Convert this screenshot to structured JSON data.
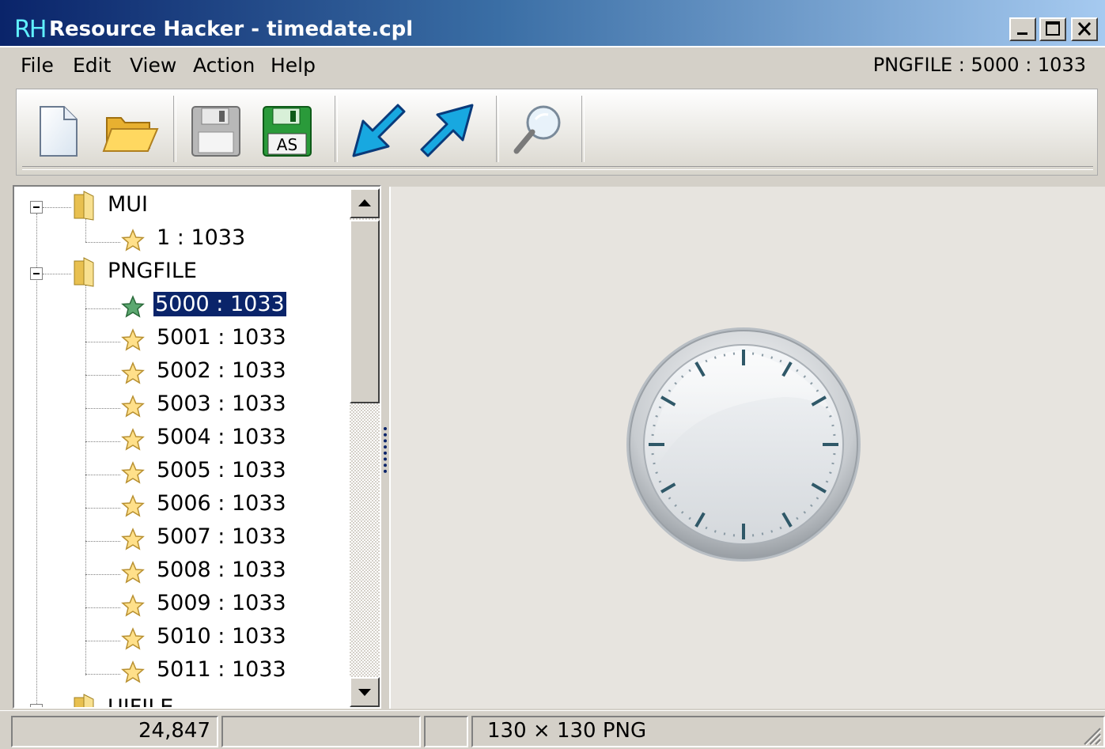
{
  "window": {
    "logo": "RH",
    "title": "Resource Hacker - timedate.cpl"
  },
  "menu": {
    "file": "File",
    "edit": "Edit",
    "view": "View",
    "action": "Action",
    "help": "Help",
    "resource_id": "PNGFILE : 5000 : 1033"
  },
  "toolbar": {
    "icons": [
      "new-file-icon",
      "open-folder-icon",
      "save-icon",
      "save-as-icon",
      "import-arrow-icon",
      "export-arrow-icon",
      "search-icon"
    ],
    "save_as_label": "AS"
  },
  "tree": {
    "groups": [
      {
        "label": "MUI",
        "items": [
          "1 : 1033"
        ]
      },
      {
        "label": "PNGFILE",
        "items": [
          "5000 : 1033",
          "5001 : 1033",
          "5002 : 1033",
          "5003 : 1033",
          "5004 : 1033",
          "5005 : 1033",
          "5006 : 1033",
          "5007 : 1033",
          "5008 : 1033",
          "5009 : 1033",
          "5010 : 1033",
          "5011 : 1033"
        ]
      },
      {
        "label": "UIFILE",
        "items": []
      }
    ],
    "selected": "5000 : 1033"
  },
  "preview": {
    "image": "clock-face-icon"
  },
  "status": {
    "size": "24,847",
    "panel2": "",
    "panel3": "",
    "image_info": "130 × 130  PNG"
  },
  "colors": {
    "selection": "#0a246a",
    "titlebar_start": "#0a246a",
    "titlebar_end": "#a6caf0"
  }
}
